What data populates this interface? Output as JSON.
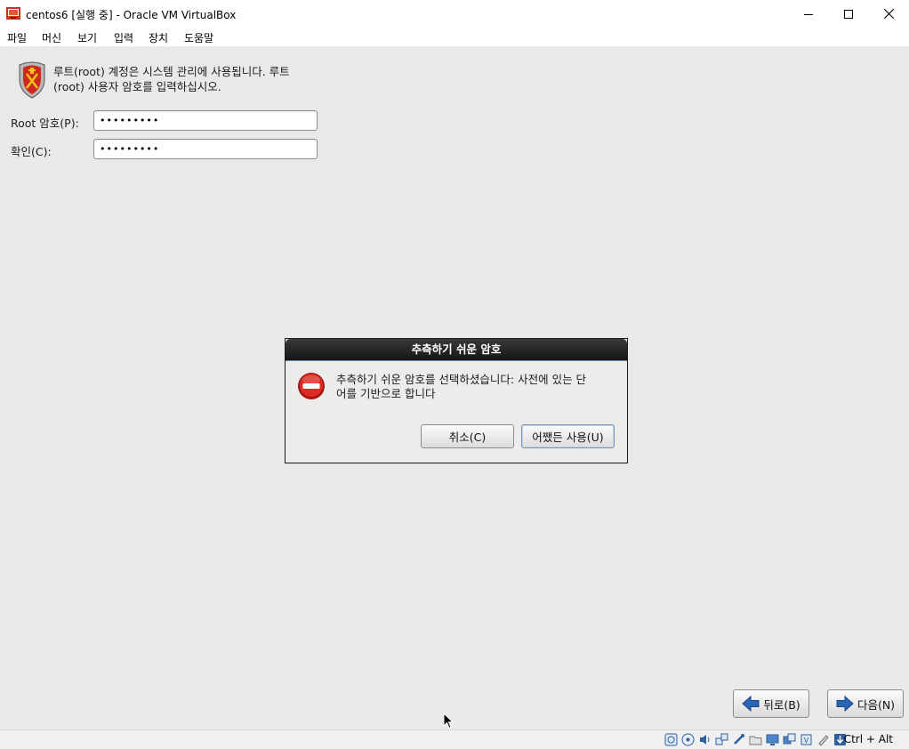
{
  "window": {
    "title": "centos6 [실행 중] - Oracle VM VirtualBox"
  },
  "menu": [
    "파일",
    "머신",
    "보기",
    "입력",
    "장치",
    "도움말"
  ],
  "installer": {
    "intro_line1": "루트(root) 계정은 시스템 관리에 사용됩니다. 루트",
    "intro_line2": "(root) 사용자 암호를 입력하십시오.",
    "root_password_label": "Root 암호(P):",
    "root_password_value": "•••••••••",
    "confirm_label": "확인(C):",
    "confirm_value": "•••••••••",
    "back_label": "뒤로(B)",
    "next_label": "다음(N)"
  },
  "dialog": {
    "title": "추측하기 쉬운 암호",
    "message_line1": "추측하기 쉬운 암호를 선택하셨습니다: 사전에 있는 단",
    "message_line2": "어를 기반으로 합니다",
    "cancel_label": "취소(C)",
    "use_anyway_label": "어쨌든 사용(U)"
  },
  "statusbar": {
    "icons": [
      "hard-disk-icon",
      "optical-drive-icon",
      "audio-icon",
      "network-icon",
      "usb-icon",
      "shared-folders-icon",
      "display-icon",
      "video-capture-icon",
      "cpu-icon",
      "mouse-integration-icon",
      "keyboard-icon"
    ],
    "host_key": "Ctrl + Alt"
  },
  "colors": {
    "dialog_title_bg": "#1f1f1f",
    "error_red": "#d41f1f",
    "nav_arrow_blue": "#2a65b5"
  }
}
